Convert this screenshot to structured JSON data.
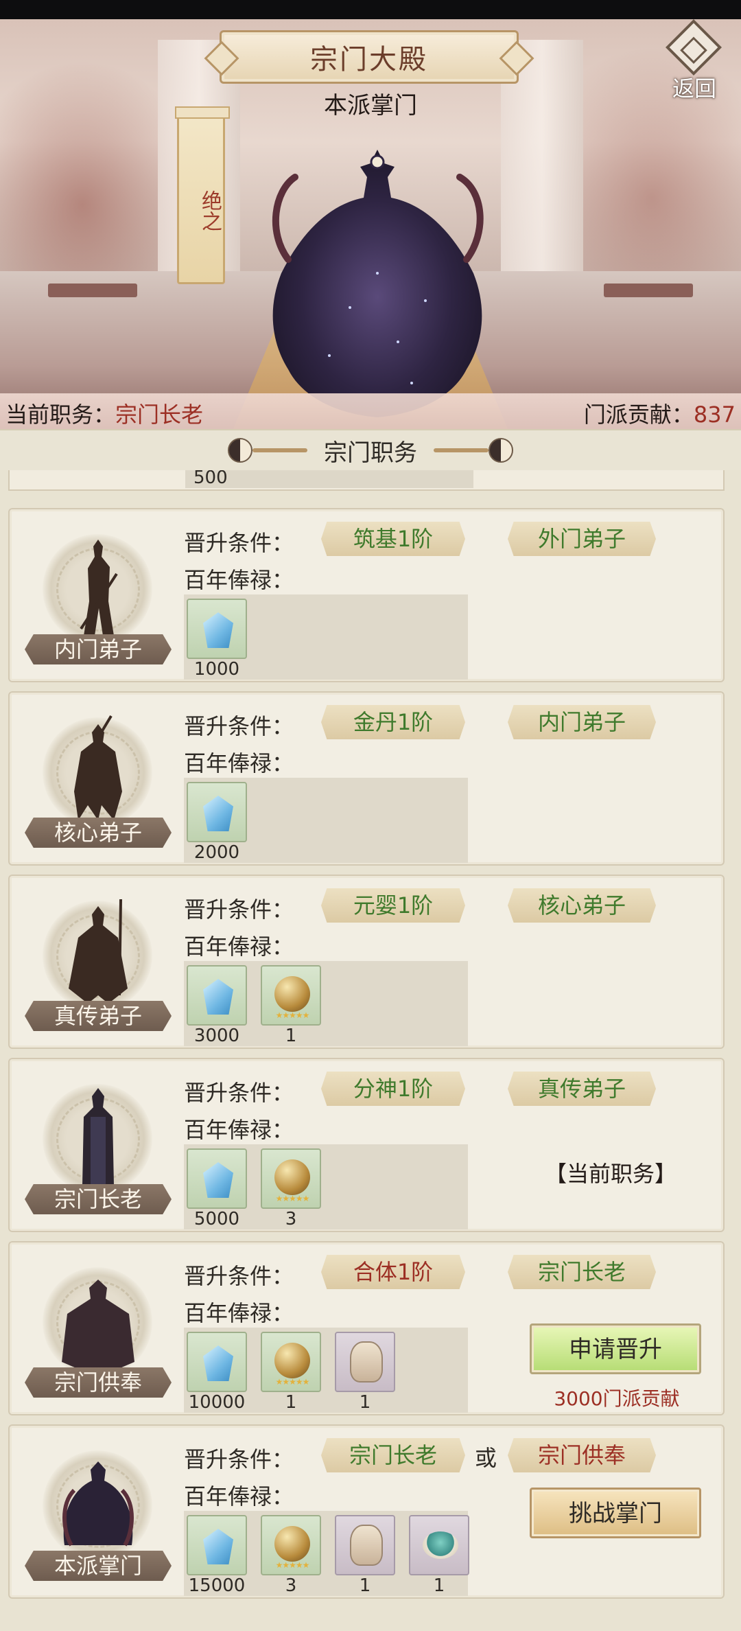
{
  "header": {
    "title": "宗门大殿",
    "back_label": "返回",
    "leader_label": "本派掌门",
    "side_scroll_text": "绝之"
  },
  "status": {
    "position_label": "当前职务：",
    "position_value": "宗门长老",
    "contribution_label": "门派贡献：",
    "contribution_value": "837"
  },
  "section": {
    "title": "宗门职务"
  },
  "partial_top": {
    "qty": "500"
  },
  "labels": {
    "requirement": "晋升条件：",
    "salary": "百年俸禄：",
    "or": "或"
  },
  "ranks": [
    {
      "name": "内门弟子",
      "req_realm": "筑基1阶",
      "req_realm_color": "green",
      "prev_rank": "外门弟子",
      "prev_rank_color": "green",
      "items": [
        {
          "icon": "spirit-stone-icon",
          "qty": "1000"
        }
      ],
      "status_text": "",
      "action_label": "",
      "cost_text": ""
    },
    {
      "name": "核心弟子",
      "req_realm": "金丹1阶",
      "req_realm_color": "green",
      "prev_rank": "内门弟子",
      "prev_rank_color": "green",
      "items": [
        {
          "icon": "spirit-stone-icon",
          "qty": "2000"
        }
      ],
      "status_text": "",
      "action_label": "",
      "cost_text": ""
    },
    {
      "name": "真传弟子",
      "req_realm": "元婴1阶",
      "req_realm_color": "green",
      "prev_rank": "核心弟子",
      "prev_rank_color": "green",
      "items": [
        {
          "icon": "spirit-stone-icon",
          "qty": "3000"
        },
        {
          "icon": "golden-pill-icon",
          "qty": "1"
        }
      ],
      "status_text": "",
      "action_label": "",
      "cost_text": ""
    },
    {
      "name": "宗门长老",
      "req_realm": "分神1阶",
      "req_realm_color": "green",
      "prev_rank": "真传弟子",
      "prev_rank_color": "green",
      "items": [
        {
          "icon": "spirit-stone-icon",
          "qty": "5000"
        },
        {
          "icon": "golden-pill-icon",
          "qty": "3"
        }
      ],
      "status_text": "【当前职务】",
      "action_label": "",
      "cost_text": ""
    },
    {
      "name": "宗门供奉",
      "req_realm": "合体1阶",
      "req_realm_color": "red",
      "prev_rank": "宗门长老",
      "prev_rank_color": "green",
      "items": [
        {
          "icon": "spirit-stone-icon",
          "qty": "10000"
        },
        {
          "icon": "golden-pill-icon",
          "qty": "1"
        },
        {
          "icon": "treasure-pouch-icon",
          "qty": "1"
        }
      ],
      "status_text": "",
      "action_label": "申请晋升",
      "cost_text": "3000门派贡献"
    },
    {
      "name": "本派掌门",
      "req_realm": "宗门长老",
      "req_realm_color": "green",
      "prev_rank": "宗门供奉",
      "prev_rank_color": "red",
      "items": [
        {
          "icon": "spirit-stone-icon",
          "qty": "15000"
        },
        {
          "icon": "golden-pill-icon",
          "qty": "3"
        },
        {
          "icon": "treasure-pouch-icon",
          "qty": "1"
        },
        {
          "icon": "jade-pearl-icon",
          "qty": "1"
        }
      ],
      "status_text": "",
      "action_label": "挑战掌门",
      "cost_text": ""
    }
  ],
  "colors": {
    "green_text": "#3f7a2c",
    "red_text": "#9c2f24",
    "apply_button": "#b5dc73",
    "challenge_button": "#ddbd83"
  }
}
